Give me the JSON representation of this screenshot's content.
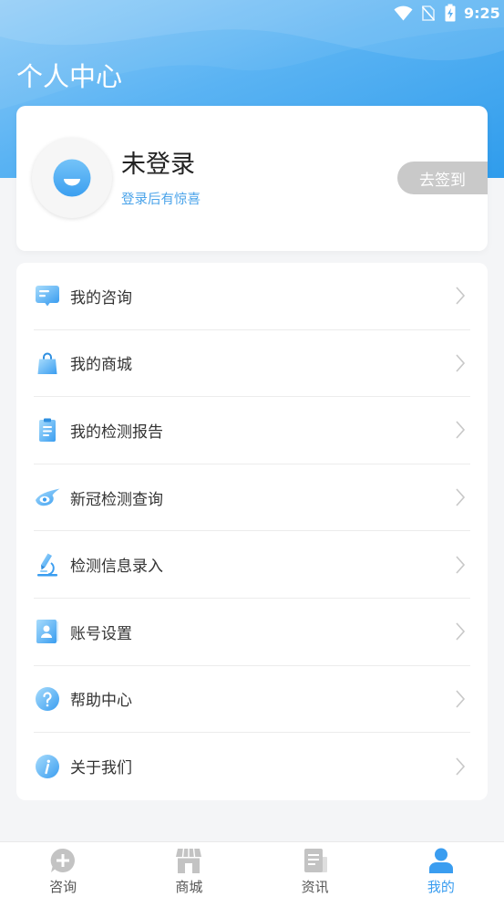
{
  "status_bar": {
    "time": "9:25",
    "icons": [
      "wifi-icon",
      "no-sim-icon",
      "battery-charging-icon"
    ]
  },
  "header": {
    "title": "个人中心"
  },
  "profile": {
    "avatar_icon": "smiley-icon",
    "name": "未登录",
    "hint": "登录后有惊喜",
    "checkin_label": "去签到"
  },
  "menu": [
    {
      "label": "我的咨询",
      "icon": "chat-bubble-icon"
    },
    {
      "label": "我的商城",
      "icon": "shopping-bag-icon"
    },
    {
      "label": "我的检测报告",
      "icon": "clipboard-report-icon"
    },
    {
      "label": "新冠检测查询",
      "icon": "covid-eye-icon"
    },
    {
      "label": "检测信息录入",
      "icon": "microscope-pen-icon"
    },
    {
      "label": "账号设置",
      "icon": "account-card-icon"
    },
    {
      "label": "帮助中心",
      "icon": "help-icon"
    },
    {
      "label": "关于我们",
      "icon": "info-icon"
    }
  ],
  "tabbar": [
    {
      "label": "咨询",
      "icon": "consult-plus-icon",
      "active": false
    },
    {
      "label": "商城",
      "icon": "store-icon",
      "active": false
    },
    {
      "label": "资讯",
      "icon": "news-icon",
      "active": false
    },
    {
      "label": "我的",
      "icon": "profile-icon",
      "active": true
    }
  ],
  "colors": {
    "accent": "#3a9df0",
    "hint": "#4aa3ea",
    "checkin_bg": "#c9c9c9",
    "tab_inactive": "#c3c3c3",
    "page_bg": "#f4f5f7"
  }
}
